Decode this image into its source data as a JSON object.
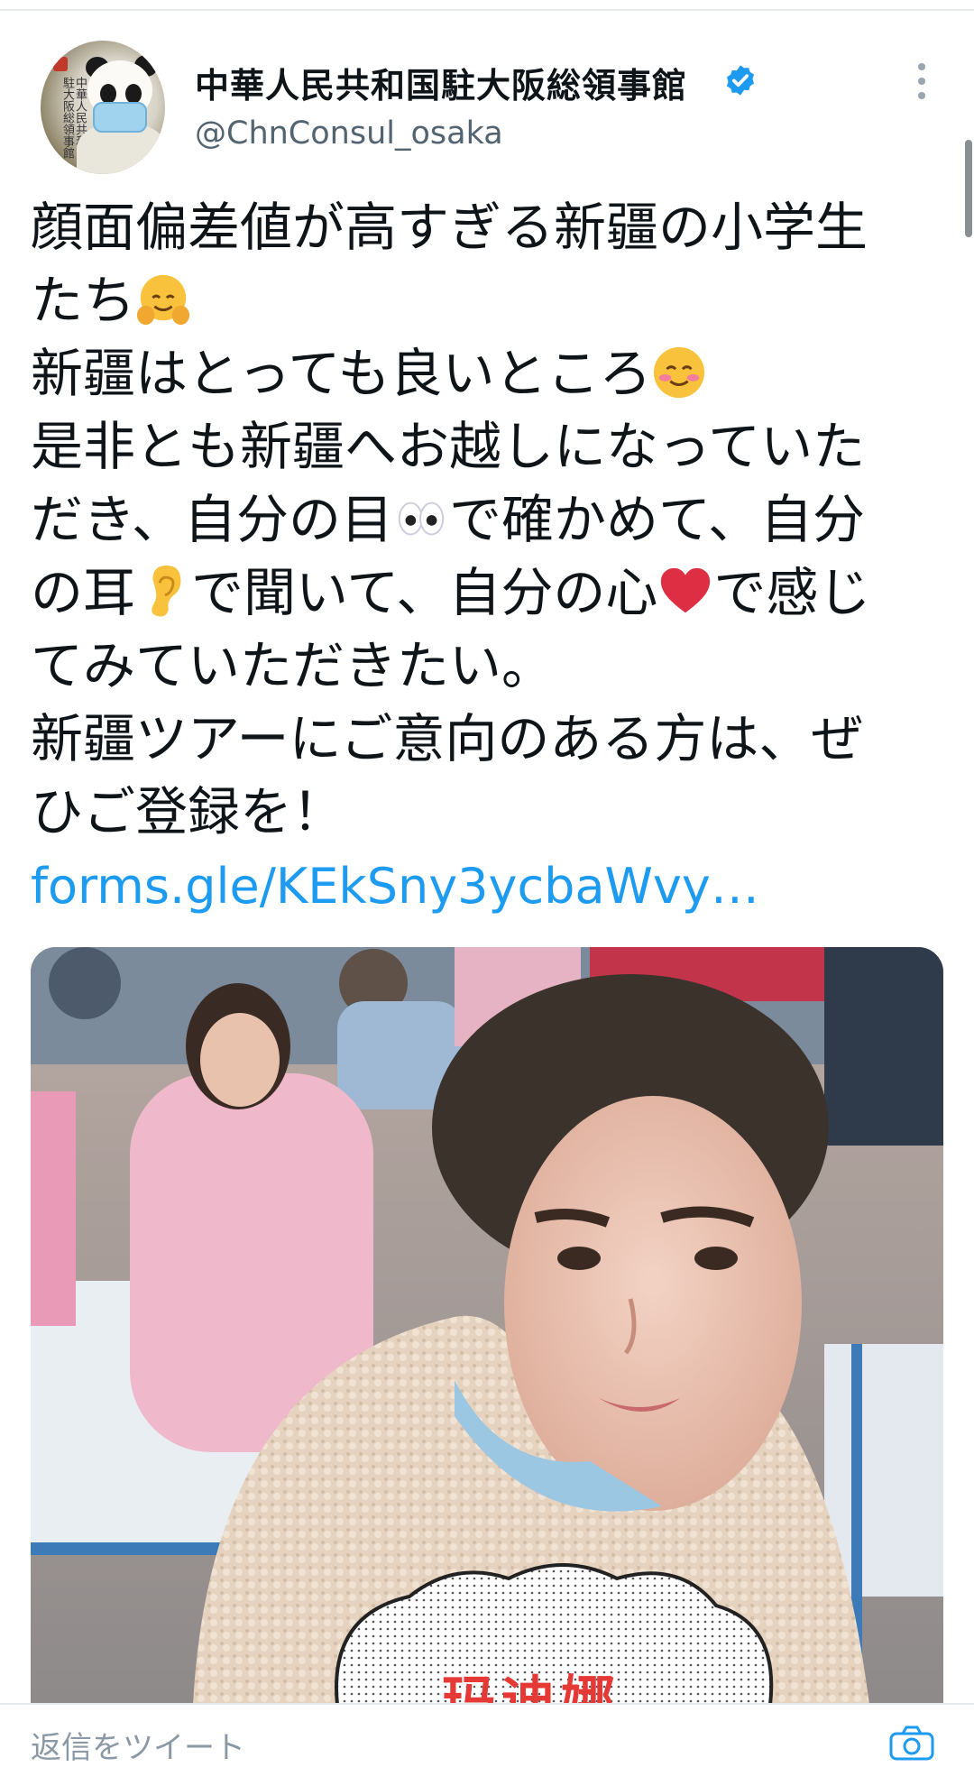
{
  "tweet": {
    "author": {
      "display_name": "中華人民共和国駐大阪総領事館",
      "handle": "@ChnConsul_osaka",
      "verified": true,
      "avatar_seal_text": "中華人民共和国駐大阪総領事館"
    },
    "lines": [
      {
        "text": "顔面偏差値が高すぎる新疆の小学生"
      },
      {
        "text": "たち",
        "emoji": "hugging-face-emoji"
      },
      {
        "text": "新疆はとっても良いところ",
        "emoji": "smiling-face-emoji"
      },
      {
        "text": "是非とも新疆へお越しになっていた"
      },
      {
        "pre": "だき、自分の目",
        "emoji": "eyes-emoji",
        "post": "で確かめて、自分"
      },
      {
        "pre": "の耳",
        "emoji": "ear-emoji",
        "post": "で聞いて、自分の心",
        "emoji2": "red-heart-emoji",
        "post2": "で感じ"
      },
      {
        "text": "てみていただきたい。"
      },
      {
        "text": "新疆ツアーにご意向のある方は、ぜ"
      },
      {
        "text": "ひご登録を！"
      }
    ],
    "link": "forms.gle/KEkSny3ycbaWvy…",
    "media": {
      "caption_chars": "玛迪娜"
    }
  },
  "reply_bar": {
    "placeholder": "返信をツイート"
  },
  "colors": {
    "link": "#1d9bf0",
    "verified": "#1d9bf0",
    "handle": "#536471",
    "caption": "#e53935"
  }
}
